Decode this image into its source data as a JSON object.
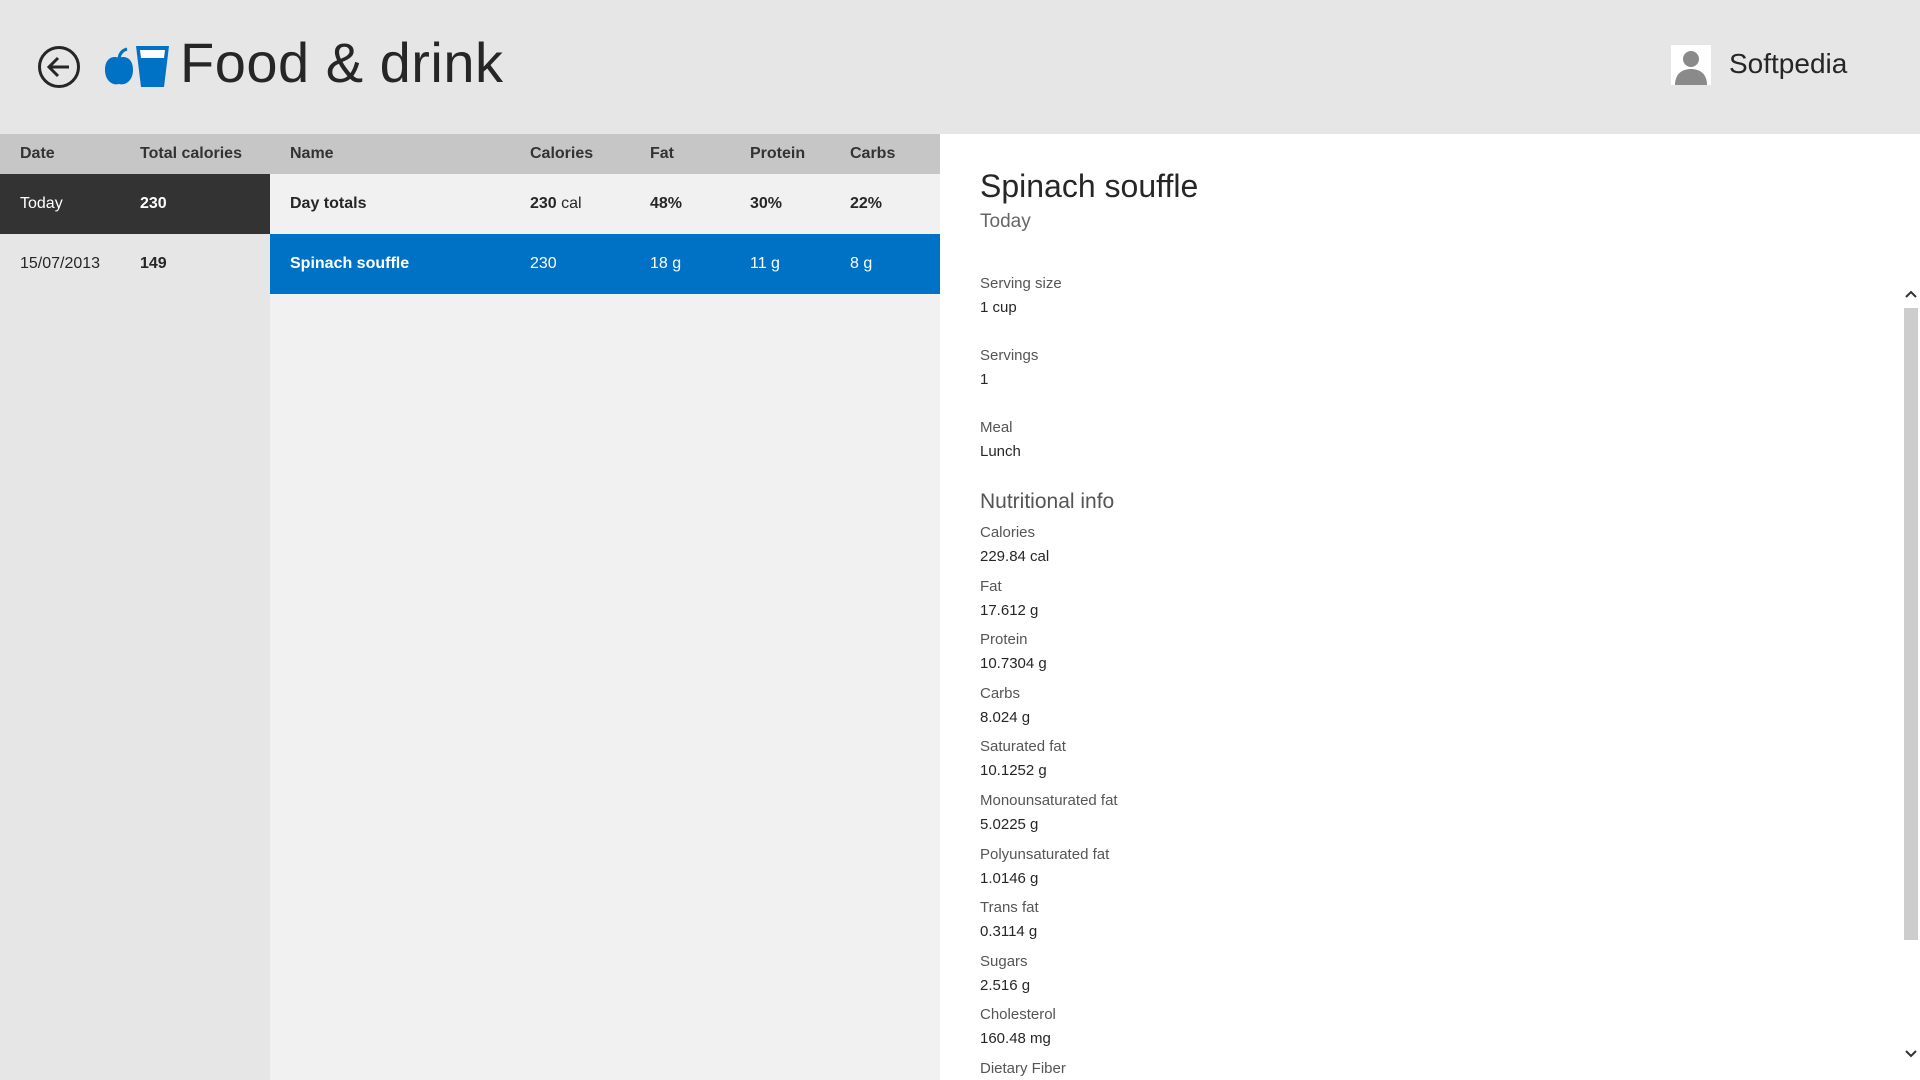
{
  "header": {
    "back_icon": "back-arrow-icon",
    "logo_icon": "apple-glass-icon",
    "title": "Food & drink",
    "user_icon": "user-avatar-icon",
    "user_name": "Softpedia"
  },
  "colors": {
    "accent": "#0072c6",
    "selected_dark": "#333333",
    "header_bg": "#e6e6e6"
  },
  "dates": {
    "headers": {
      "date": "Date",
      "total": "Total calories"
    },
    "rows": [
      {
        "date": "Today",
        "calories": "230"
      },
      {
        "date": "15/07/2013",
        "calories": "149"
      }
    ]
  },
  "entries": {
    "headers": {
      "name": "Name",
      "calories": "Calories",
      "fat": "Fat",
      "protein": "Protein",
      "carbs": "Carbs"
    },
    "totals": {
      "name": "Day totals",
      "calories_value": "230",
      "calories_unit": "cal",
      "fat": "48%",
      "protein": "30%",
      "carbs": "22%"
    },
    "rows": [
      {
        "name": "Spinach souffle",
        "calories": "230",
        "fat": "18 g",
        "protein": "11 g",
        "carbs": "8 g"
      }
    ]
  },
  "detail": {
    "title": "Spinach souffle",
    "subtitle": "Today",
    "serving_size_label": "Serving size",
    "serving_size": "1 cup",
    "servings_label": "Servings",
    "servings": "1",
    "meal_label": "Meal",
    "meal": "Lunch",
    "nutrition_title": "Nutritional info",
    "nutrition": [
      {
        "label": "Calories",
        "value": "229.84 cal"
      },
      {
        "label": "Fat",
        "value": "17.612 g"
      },
      {
        "label": "Protein",
        "value": "10.7304 g"
      },
      {
        "label": "Carbs",
        "value": "8.024 g"
      },
      {
        "label": "Saturated fat",
        "value": "10.1252 g"
      },
      {
        "label": "Monounsaturated fat",
        "value": "5.0225 g"
      },
      {
        "label": "Polyunsaturated fat",
        "value": "1.0146 g"
      },
      {
        "label": "Trans fat",
        "value": "0.3114 g"
      },
      {
        "label": "Sugars",
        "value": "2.516 g"
      },
      {
        "label": "Cholesterol",
        "value": "160.48 mg"
      },
      {
        "label": "Dietary Fiber",
        "value": ""
      }
    ]
  }
}
